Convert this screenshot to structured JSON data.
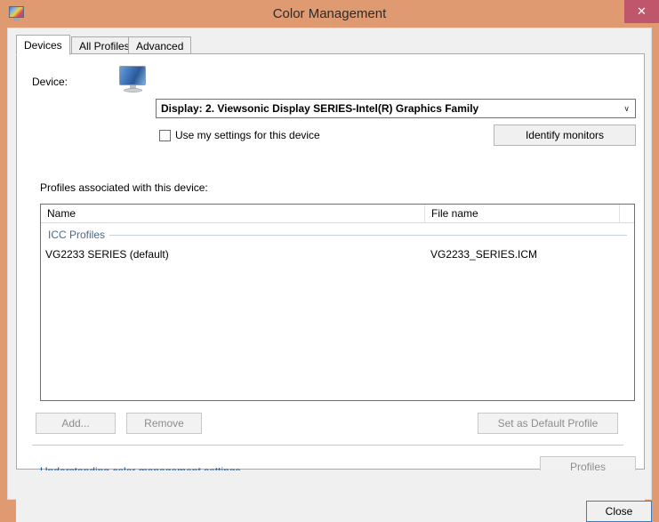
{
  "window": {
    "title": "Color Management",
    "icon": "color-monitor-icon",
    "close_glyph": "✕",
    "titlebar_color": "#e09a72",
    "close_button_color": "#c0566b"
  },
  "tabs": [
    {
      "label": "Devices",
      "active": true
    },
    {
      "label": "All Profiles",
      "active": false
    },
    {
      "label": "Advanced",
      "active": false
    }
  ],
  "devices_tab": {
    "device_label": "Device:",
    "device_combo": {
      "value": "Display: 2. Viewsonic Display SERIES-Intel(R) Graphics Family",
      "arrow_glyph": "∨"
    },
    "use_my_settings": {
      "label": "Use my settings for this device",
      "checked": false
    },
    "identify_monitors_label": "Identify monitors",
    "profiles_label": "Profiles associated with this device:",
    "list": {
      "columns": [
        "Name",
        "File name"
      ],
      "group_header": "ICC Profiles",
      "rows": [
        {
          "name": "VG2233 SERIES (default)",
          "file": "VG2233_SERIES.ICM"
        }
      ]
    },
    "buttons": {
      "add": "Add...",
      "remove": "Remove",
      "set_default": "Set as Default Profile"
    }
  },
  "footer": {
    "help_link": "Understanding color management settings",
    "profiles_button": "Profiles",
    "close_button": "Close",
    "link_color": "#1a4f96"
  }
}
